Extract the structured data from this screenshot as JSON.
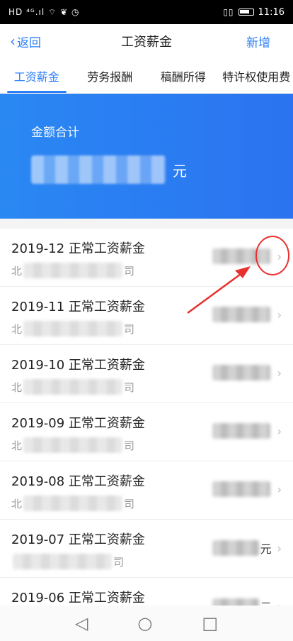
{
  "status": {
    "left_icons": "HD ⁴ᴳ.ıl ⌔ ❦ ◷",
    "right_icons": "▯▯ ▭",
    "time": "11:16"
  },
  "nav": {
    "back_label": "返回",
    "title": "工资薪金",
    "add_label": "新增"
  },
  "tabs": [
    {
      "label": "工资薪金",
      "active": true
    },
    {
      "label": "劳务报酬",
      "active": false
    },
    {
      "label": "稿酬所得",
      "active": false
    },
    {
      "label": "特许权使用费",
      "active": false
    }
  ],
  "summary": {
    "label": "金额合计",
    "unit": "元"
  },
  "list": [
    {
      "title": "2019-12 正常工资薪金",
      "company_start": "北",
      "company_end": "司",
      "unit": ""
    },
    {
      "title": "2019-11 正常工资薪金",
      "company_start": "北",
      "company_end": "司",
      "unit": ""
    },
    {
      "title": "2019-10 正常工资薪金",
      "company_start": "北",
      "company_end": "司",
      "unit": ""
    },
    {
      "title": "2019-09 正常工资薪金",
      "company_start": "北",
      "company_end": "司",
      "unit": ""
    },
    {
      "title": "2019-08 正常工资薪金",
      "company_start": "北",
      "company_end": "司",
      "unit": ""
    },
    {
      "title": "2019-07 正常工资薪金",
      "company_start": "",
      "company_end": "司",
      "unit": "元"
    },
    {
      "title": "2019-06 正常工资薪金",
      "company_start": "",
      "company_end": "",
      "unit": "元"
    }
  ],
  "sysnav": {
    "back": "◁",
    "home": "○",
    "recent": "□"
  },
  "colors": {
    "accent": "#2d7ff9",
    "banner": "#2b7ff2",
    "annotation": "#e8302f"
  }
}
